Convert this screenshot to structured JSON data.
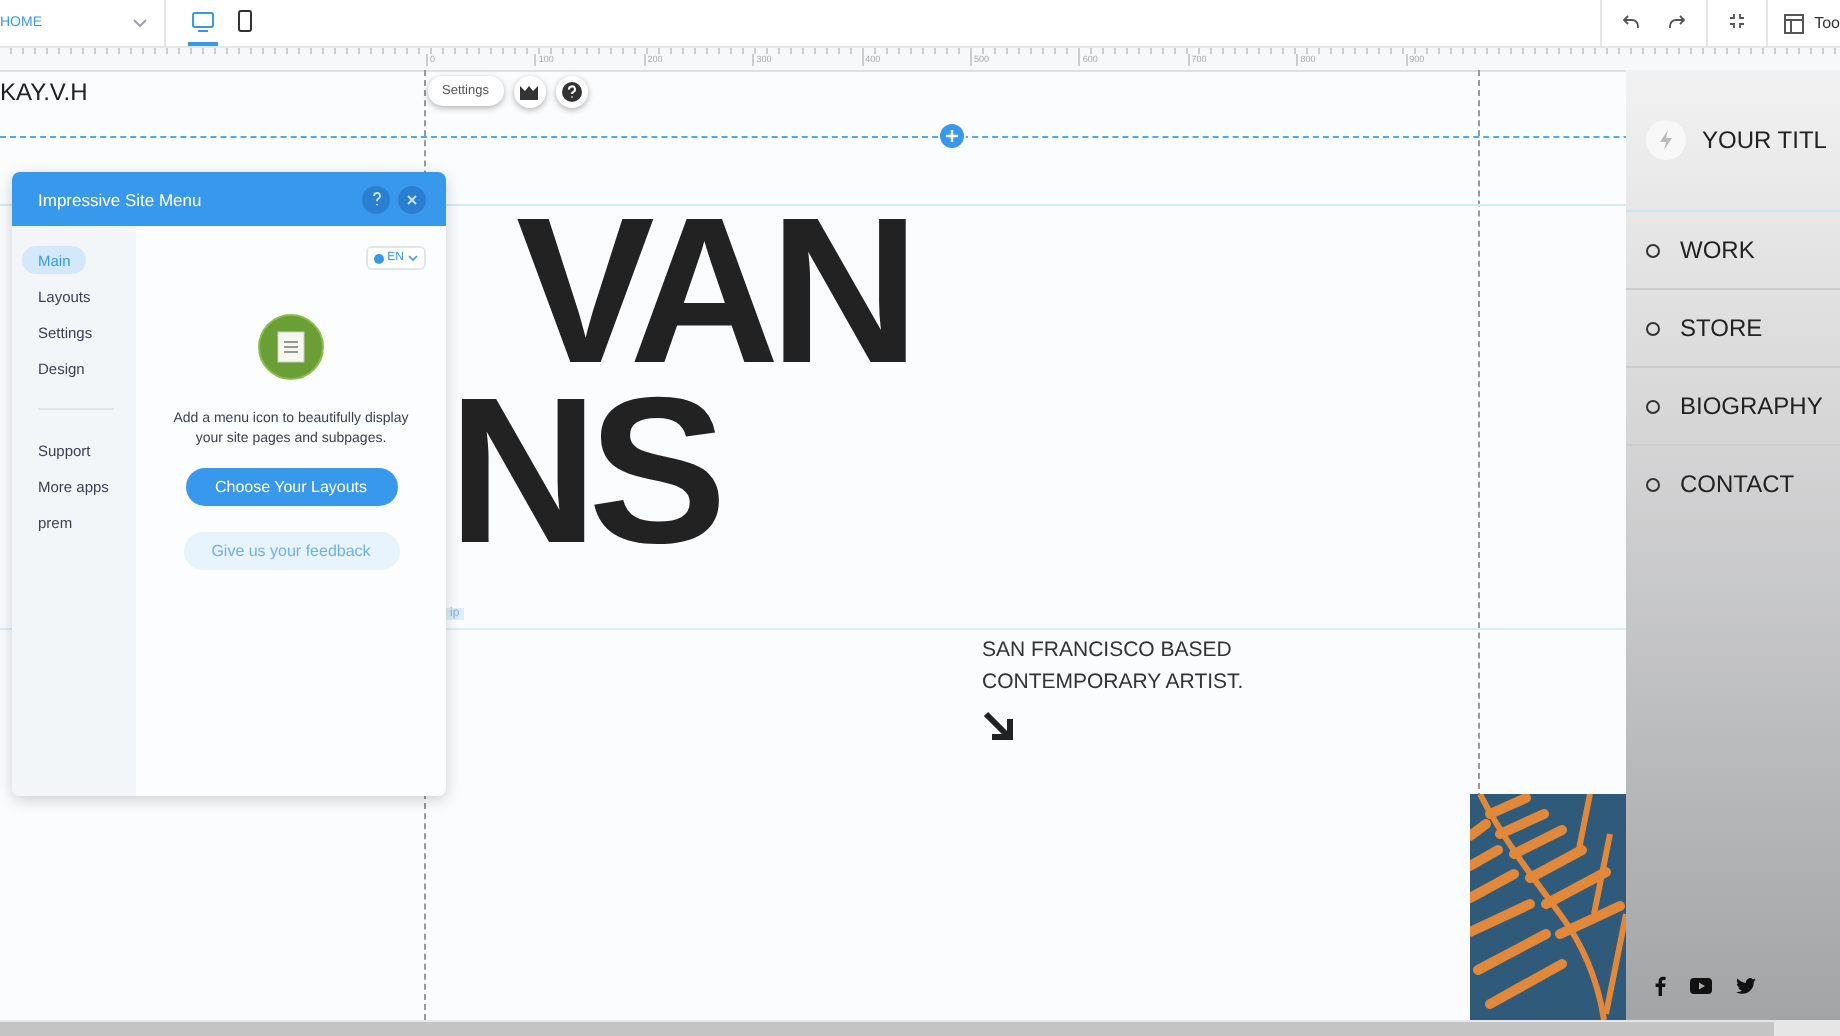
{
  "top_bar": {
    "page": "HOME",
    "views": [
      {
        "kind": "desktop",
        "selected": true
      },
      {
        "kind": "mobile",
        "selected": false
      }
    ],
    "tools_label": "Too"
  },
  "ruler": {
    "ticks": [
      "0",
      "100",
      "200",
      "300",
      "400",
      "500",
      "600",
      "700",
      "800",
      "900"
    ]
  },
  "canvas": {
    "site_name": "KAY.V.H",
    "settings_button": "Settings",
    "headline": [
      "VAN",
      "NS"
    ],
    "tagline": [
      "SAN FRANCISCO BASED",
      "CONTEMPORARY ARTIST."
    ],
    "tag": "ip"
  },
  "site_menu": {
    "title": "YOUR TITL",
    "items": [
      {
        "label": "WORK"
      },
      {
        "label": "STORE"
      },
      {
        "label": "BIOGRAPHY"
      },
      {
        "label": "CONTACT"
      }
    ]
  },
  "panel": {
    "title": "Impressive Site Menu",
    "language": "EN",
    "nav": [
      {
        "label": "Main",
        "selected": true
      },
      {
        "label": "Layouts",
        "selected": false
      },
      {
        "label": "Settings",
        "selected": false
      },
      {
        "label": "Design",
        "selected": false
      }
    ],
    "nav_secondary": [
      {
        "label": "Support"
      },
      {
        "label": "More apps"
      },
      {
        "label": "prem"
      }
    ],
    "description": "Add a menu icon to beautifully display your site pages and subpages.",
    "primary_button": "Choose Your Layouts",
    "secondary_button": "Give us your feedback"
  }
}
